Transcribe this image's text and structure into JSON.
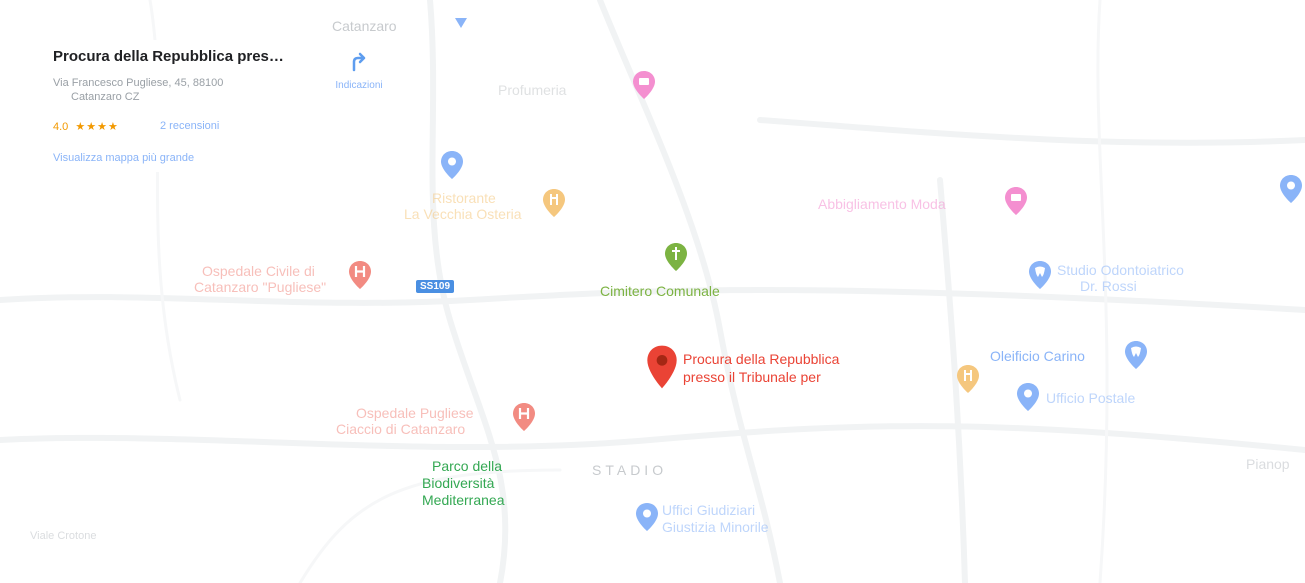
{
  "info_card": {
    "title": "Procura della Repubblica pres…",
    "address_line1": "Via Francesco Pugliese, 45, 88100",
    "address_line2": "Catanzaro CZ",
    "rating": "4.0",
    "stars": "★★★★",
    "reviews": "2 recensioni",
    "view_larger_map": "Visualizza mappa più grande"
  },
  "directions": {
    "label": "Indicazioni"
  },
  "map": {
    "top_label": "Catanzaro",
    "main_place": {
      "line1": "Procura della Repubblica",
      "line2": "presso il Tribunale per"
    },
    "cemetery": "Cimitero Comunale",
    "hospital_1": {
      "line1": "Ospedale Civile di",
      "line2": "Catanzaro \"Pugliese\""
    },
    "hospital_2": {
      "line1": "Ospedale Pugliese",
      "line2": "Ciaccio di Catanzaro"
    },
    "restaurant": {
      "line1": "Ristorante",
      "line2": "La Vecchia Osteria"
    },
    "shop_1": "Profumeria",
    "shop_2": "Abbigliamento Moda",
    "dental": {
      "line1": "Studio Odontoiatrico",
      "line2": "Dr. Rossi"
    },
    "clinic": "Oleificio Carino",
    "poi_2": "Ufficio Postale",
    "court": {
      "line1": "Uffici Giudiziari",
      "line2": "Giustizia Minorile"
    },
    "park": {
      "line1": "Parco della",
      "line2": "Biodiversità",
      "line3": "Mediterranea"
    },
    "district": "STADIO",
    "road_shield": "SS109",
    "right_edge_label": "Pianop",
    "left_bottom_label": "Viale Crotone"
  },
  "colors": {
    "main_pin": "#ea4335",
    "cemetery": "#7cb342",
    "hospital": "#f28b82",
    "shopping": "#f48fd0",
    "food": "#f5c77e",
    "service": "#8ab4f8",
    "park_text": "#34a853"
  }
}
